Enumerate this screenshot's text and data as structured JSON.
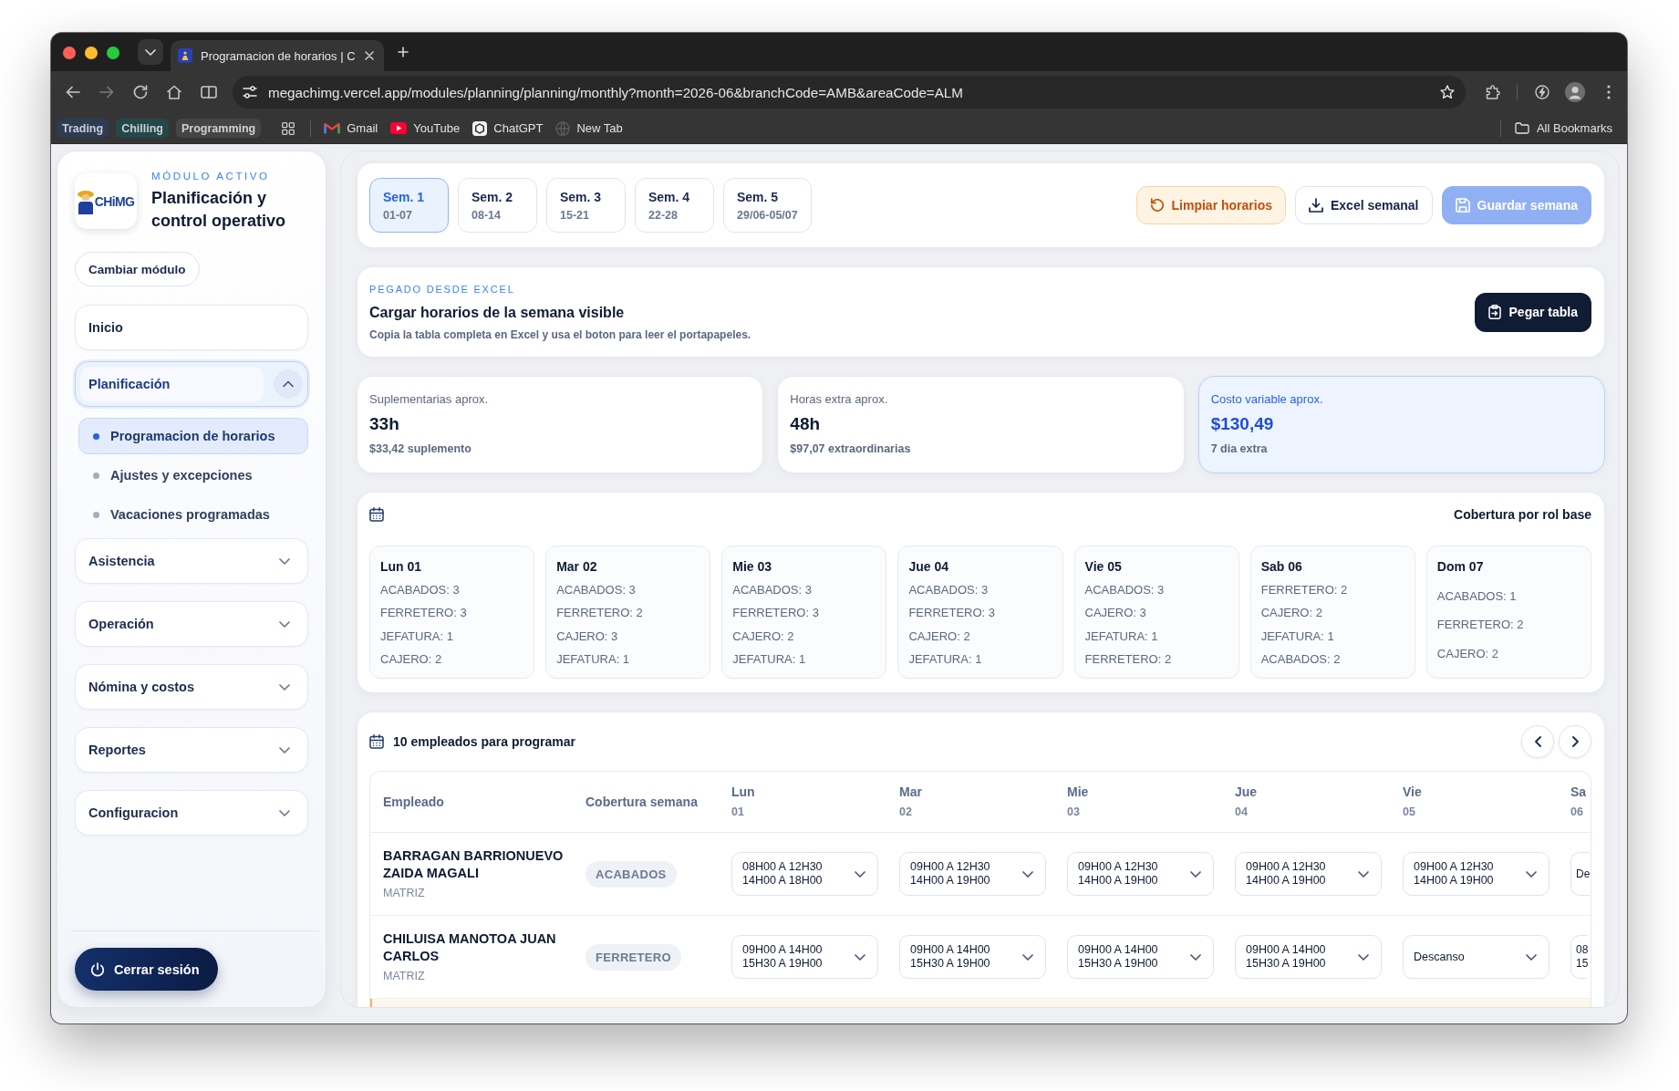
{
  "browser": {
    "tab_title": "Programacion de horarios | C",
    "url": "megachimg.vercel.app/modules/planning/planning/monthly?month=2026-06&branchCode=AMB&areaCode=ALM",
    "bookmarks": [
      {
        "label": "Trading",
        "kind": "group",
        "color": "#2d3b53"
      },
      {
        "label": "Chilling",
        "kind": "group",
        "color": "#24474a"
      },
      {
        "label": "Programming",
        "kind": "group",
        "color": "#454547"
      },
      {
        "label": "Gmail",
        "kind": "site"
      },
      {
        "label": "YouTube",
        "kind": "site"
      },
      {
        "label": "ChatGPT",
        "kind": "site"
      },
      {
        "label": "New Tab",
        "kind": "site"
      }
    ],
    "all_bookmarks": "All Bookmarks"
  },
  "sidebar": {
    "logo_text": "CHiMG",
    "module_caption": "MÓDULO ACTIVO",
    "module_title": "Planificación y control operativo",
    "change_module": "Cambiar módulo",
    "nav": [
      {
        "label": "Inicio",
        "kind": "link"
      },
      {
        "label": "Planificación",
        "kind": "group",
        "expanded": true,
        "children": [
          {
            "label": "Programacion de horarios",
            "selected": true
          },
          {
            "label": "Ajustes y excepciones",
            "selected": false
          },
          {
            "label": "Vacaciones programadas",
            "selected": false
          }
        ]
      },
      {
        "label": "Asistencia",
        "kind": "group",
        "expanded": false
      },
      {
        "label": "Operación",
        "kind": "group",
        "expanded": false
      },
      {
        "label": "Nómina y costos",
        "kind": "group",
        "expanded": false
      },
      {
        "label": "Reportes",
        "kind": "group",
        "expanded": false
      },
      {
        "label": "Configuracion",
        "kind": "group",
        "expanded": false
      }
    ],
    "logout": "Cerrar sesión"
  },
  "weeks": {
    "tabs": [
      {
        "label": "Sem. 1",
        "range": "01-07",
        "selected": true
      },
      {
        "label": "Sem. 2",
        "range": "08-14",
        "selected": false
      },
      {
        "label": "Sem. 3",
        "range": "15-21",
        "selected": false
      },
      {
        "label": "Sem. 4",
        "range": "22-28",
        "selected": false
      },
      {
        "label": "Sem. 5",
        "range": "29/06-05/07",
        "selected": false
      }
    ],
    "actions": [
      {
        "label": "Limpiar horarios",
        "kind": "reset",
        "disabled": false
      },
      {
        "label": "Excel semanal",
        "kind": "export",
        "disabled": false
      },
      {
        "label": "Guardar semana",
        "kind": "save",
        "disabled": true
      }
    ]
  },
  "paste": {
    "caption": "PEGADO DESDE EXCEL",
    "title": "Cargar horarios de la semana visible",
    "description": "Copia la tabla completa en Excel y usa el boton para leer el portapapeles.",
    "button": "Pegar tabla"
  },
  "stats": [
    {
      "label": "Suplementarias aprox.",
      "value": "33h",
      "detail": "$33,42 suplemento",
      "highlighted": false
    },
    {
      "label": "Horas extra aprox.",
      "value": "48h",
      "detail": "$97,07 extraordinarias",
      "highlighted": false
    },
    {
      "label": "Costo variable aprox.",
      "value": "$130,49",
      "detail": "7 dia extra",
      "highlighted": true
    }
  ],
  "coverage": {
    "title": "Cobertura por rol base",
    "days": [
      {
        "day": "Lun 01",
        "roles": [
          "ACABADOS: 3",
          "FERRETERO: 3",
          "JEFATURA: 1",
          "CAJERO: 2"
        ]
      },
      {
        "day": "Mar 02",
        "roles": [
          "ACABADOS: 3",
          "FERRETERO: 2",
          "CAJERO: 3",
          "JEFATURA: 1"
        ]
      },
      {
        "day": "Mie 03",
        "roles": [
          "ACABADOS: 3",
          "FERRETERO: 3",
          "CAJERO: 2",
          "JEFATURA: 1"
        ]
      },
      {
        "day": "Jue 04",
        "roles": [
          "ACABADOS: 3",
          "FERRETERO: 3",
          "CAJERO: 2",
          "JEFATURA: 1"
        ]
      },
      {
        "day": "Vie 05",
        "roles": [
          "ACABADOS: 3",
          "CAJERO: 3",
          "JEFATURA: 1",
          "FERRETERO: 2"
        ]
      },
      {
        "day": "Sab 06",
        "roles": [
          "FERRETERO: 2",
          "CAJERO: 2",
          "JEFATURA: 1",
          "ACABADOS: 2"
        ]
      },
      {
        "day": "Dom 07",
        "roles": [
          "ACABADOS: 1",
          "FERRETERO: 2",
          "CAJERO: 2"
        ]
      }
    ]
  },
  "schedule": {
    "title": "10 empleados para programar",
    "columns": [
      "Empleado",
      "Cobertura semana"
    ],
    "days": [
      {
        "label": "Lun",
        "date": "01"
      },
      {
        "label": "Mar",
        "date": "02"
      },
      {
        "label": "Mie",
        "date": "03"
      },
      {
        "label": "Jue",
        "date": "04"
      },
      {
        "label": "Vie",
        "date": "05"
      },
      {
        "label": "Sa",
        "date": "06"
      }
    ],
    "rows": [
      {
        "name": "BARRAGAN BARRIONUEVO ZAIDA MAGALI",
        "branch": "MATRIZ",
        "role": "ACABADOS",
        "shifts": [
          [
            "08H00 A 12H30",
            "14H00 A 18H00"
          ],
          [
            "09H00 A 12H30",
            "14H00 A 19H00"
          ],
          [
            "09H00 A 12H30",
            "14H00 A 19H00"
          ],
          [
            "09H00 A 12H30",
            "14H00 A 19H00"
          ],
          [
            "09H00 A 12H30",
            "14H00 A 19H00"
          ],
          [
            "De"
          ]
        ]
      },
      {
        "name": "CHILUISA MANOTOA JUAN CARLOS",
        "branch": "MATRIZ",
        "role": "FERRETERO",
        "shifts": [
          [
            "09H00 A 14H00",
            "15H30 A 19H00"
          ],
          [
            "09H00 A 14H00",
            "15H30 A 19H00"
          ],
          [
            "09H00 A 14H00",
            "15H30 A 19H00"
          ],
          [
            "09H00 A 14H00",
            "15H30 A 19H00"
          ],
          [
            "Descanso"
          ],
          [
            "08",
            "15"
          ]
        ]
      }
    ],
    "next_row": {
      "highlighted": true
    }
  }
}
